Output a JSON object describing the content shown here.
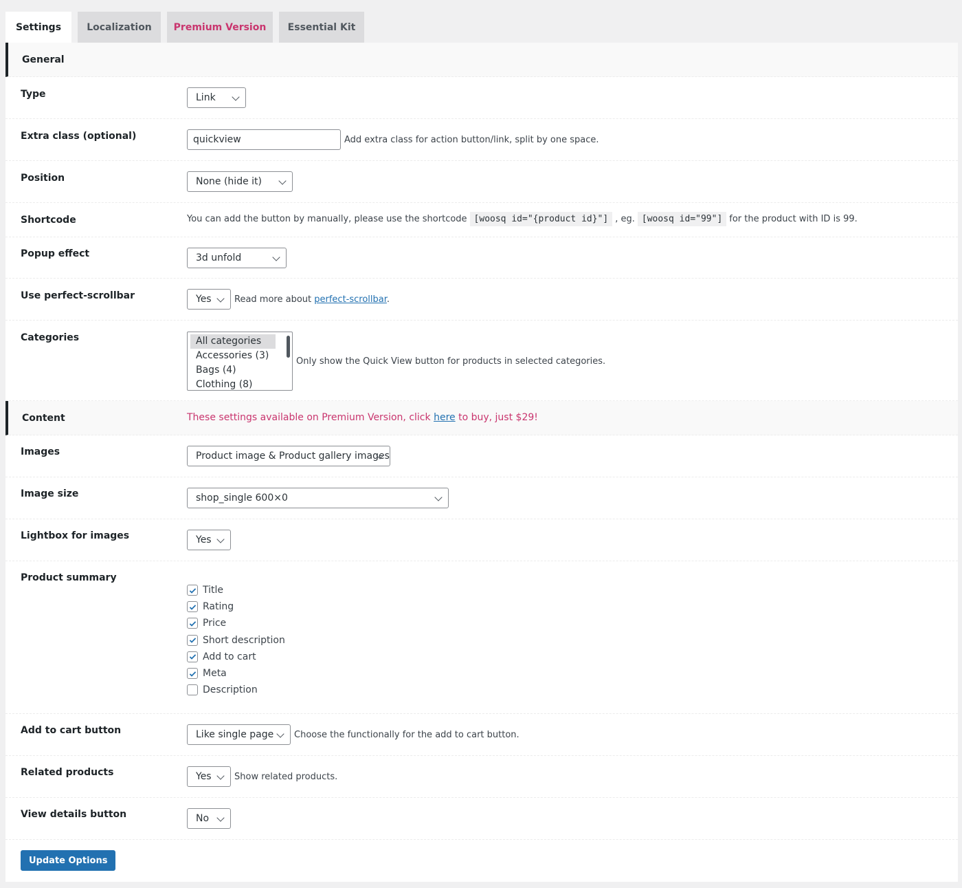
{
  "tabs": [
    {
      "label": "Settings"
    },
    {
      "label": "Localization"
    },
    {
      "label": "Premium Version"
    },
    {
      "label": "Essential Kit"
    }
  ],
  "general": {
    "heading": "General",
    "type": {
      "label": "Type",
      "value": "Link"
    },
    "extra_class": {
      "label": "Extra class (optional)",
      "value": "quickview",
      "desc": "Add extra class for action button/link, split by one space."
    },
    "position": {
      "label": "Position",
      "value": "None (hide it)"
    },
    "shortcode": {
      "label": "Shortcode",
      "text1": "You can add the button by manually, please use the shortcode",
      "code1": "[woosq id=\"{product id}\"]",
      "text2": ", eg.",
      "code2": "[woosq id=\"99\"]",
      "text3": "for the product with ID is 99."
    },
    "popup_effect": {
      "label": "Popup effect",
      "value": "3d unfold"
    },
    "scrollbar": {
      "label": "Use perfect-scrollbar",
      "value": "Yes",
      "desc": "Read more about",
      "link": "perfect-scrollbar",
      "after": "."
    },
    "categories": {
      "label": "Categories",
      "options": [
        "All categories",
        "Accessories  (3)",
        "Bags  (4)",
        "Clothing  (8)"
      ],
      "desc": "Only show the Quick View button for products in selected categories."
    }
  },
  "content": {
    "heading": "Content",
    "premium_note": {
      "text1": "These settings available on Premium Version, click",
      "link": "here",
      "text2": "to buy, just $29!"
    },
    "images": {
      "label": "Images",
      "value": "Product image & Product gallery images"
    },
    "image_size": {
      "label": "Image size",
      "value": "shop_single 600×0"
    },
    "lightbox": {
      "label": "Lightbox for images",
      "value": "Yes"
    },
    "summary": {
      "label": "Product summary",
      "items": [
        {
          "label": "Title",
          "checked": true
        },
        {
          "label": "Rating",
          "checked": true
        },
        {
          "label": "Price",
          "checked": true
        },
        {
          "label": "Short description",
          "checked": true
        },
        {
          "label": "Add to cart",
          "checked": true
        },
        {
          "label": "Meta",
          "checked": true
        },
        {
          "label": "Description",
          "checked": false
        }
      ]
    },
    "add_to_cart": {
      "label": "Add to cart button",
      "value": "Like single page",
      "desc": "Choose the functionally for the add to cart button."
    },
    "related": {
      "label": "Related products",
      "value": "Yes",
      "desc": "Show related products."
    },
    "view_details": {
      "label": "View details button",
      "value": "No"
    }
  },
  "submit_label": "Update Options",
  "colors": {
    "accent": "#2271b1",
    "premium": "#c9356e"
  }
}
